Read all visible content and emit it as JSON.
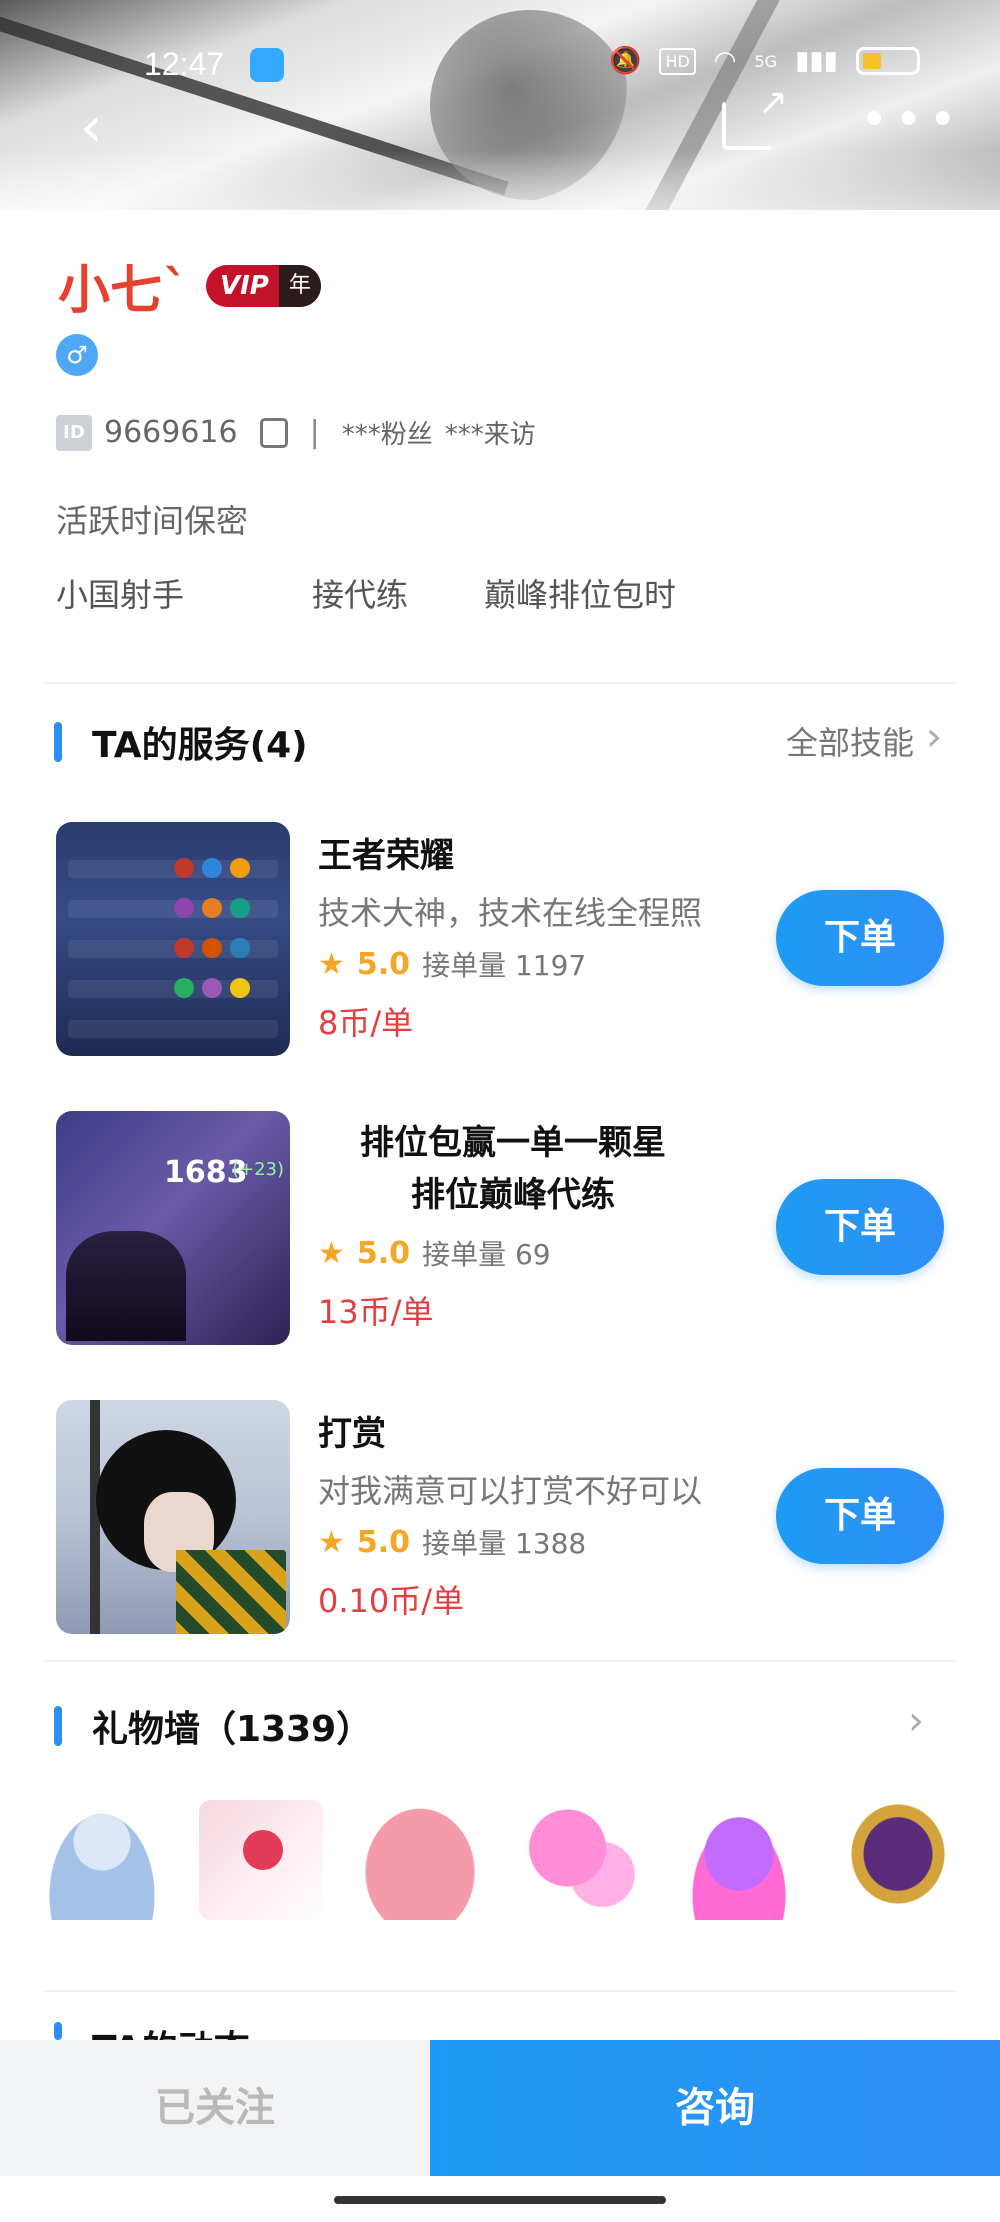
{
  "status_bar": {
    "time": "12:47",
    "hd": "HD",
    "network": "5G"
  },
  "nav": {
    "back": "‹",
    "more": "•••"
  },
  "profile": {
    "name": "小七`",
    "vip_label": "VIP",
    "vip_term": "年",
    "gender_symbol": "♂",
    "id_label": "ID",
    "id": "9669616",
    "separator": "|",
    "fans": "***粉丝",
    "visitors": "***来访",
    "active_time": "活跃时间保密",
    "tags": [
      "小国射手",
      "接代练",
      "巅峰排位包时"
    ]
  },
  "services_section": {
    "title": "TA的服务(4)",
    "all_link": "全部技能",
    "chevron": "›",
    "items": [
      {
        "title": "王者荣耀",
        "desc": "技术大神，技术在线全程照",
        "star": "★",
        "rating": "5.0",
        "orders": "接单量 1197",
        "price": "8币/单",
        "button": "下单"
      },
      {
        "title_line1": "排位包赢一单一颗星",
        "title_line2": "排位巅峰代练",
        "star": "★",
        "rating": "5.0",
        "orders": "接单量 69",
        "price": "13币/单",
        "button": "下单",
        "thumb_score": "1683",
        "thumb_plus": "(+23)"
      },
      {
        "title": "打赏",
        "desc": "对我满意可以打赏不好可以",
        "star": "★",
        "rating": "5.0",
        "orders": "接单量 1388",
        "price": "0.10币/单",
        "button": "下单"
      }
    ]
  },
  "gift_section": {
    "title": "礼物墙（1339）",
    "chevron": "›"
  },
  "cut_section": {
    "title": "TA的动态"
  },
  "bottom": {
    "follow": "已关注",
    "consult": "咨询"
  }
}
